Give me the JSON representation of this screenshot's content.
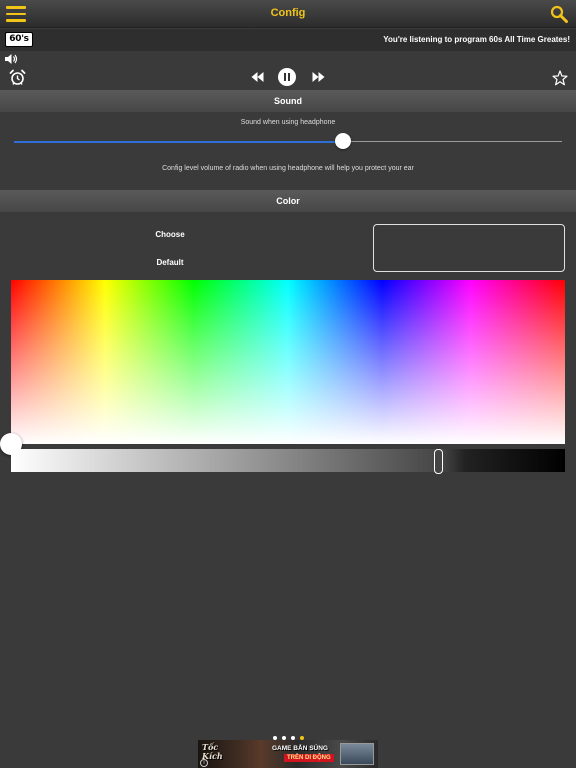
{
  "header": {
    "title": "Config",
    "menu_icon": "hamburger-menu-icon",
    "search_icon": "magnifier-icon",
    "accent_color": "#f0c419"
  },
  "now_playing": {
    "logo_text": "60's",
    "text": "You're listening to program 60s All Time Greates!"
  },
  "player": {
    "volume_icon": "speaker-icon",
    "alarm_icon": "alarm-clock-icon",
    "rewind_icon": "rewind-icon",
    "pause_icon": "pause-icon",
    "forward_icon": "fast-forward-icon",
    "favorite_icon": "star-outline-icon"
  },
  "sound": {
    "header": "Sound",
    "caption": "Sound when using headphone",
    "volume_level": 0.6,
    "slider_fill_color": "#2d6fd6",
    "description": "Config level volume of radio when using headphone will help you protect your ear"
  },
  "color": {
    "header": "Color",
    "choose_label": "Choose",
    "default_label": "Default",
    "preview_color": "#3a3a3a",
    "brightness_level": 0.77
  },
  "pager": {
    "count": 4,
    "active_index": 3,
    "active_color": "#f0c419"
  },
  "ad": {
    "brand_line1": "Tốc",
    "brand_line2": "Kích",
    "headline": "GAME BẮN SÚNG",
    "subline": "TRÊN DI ĐỘNG"
  }
}
